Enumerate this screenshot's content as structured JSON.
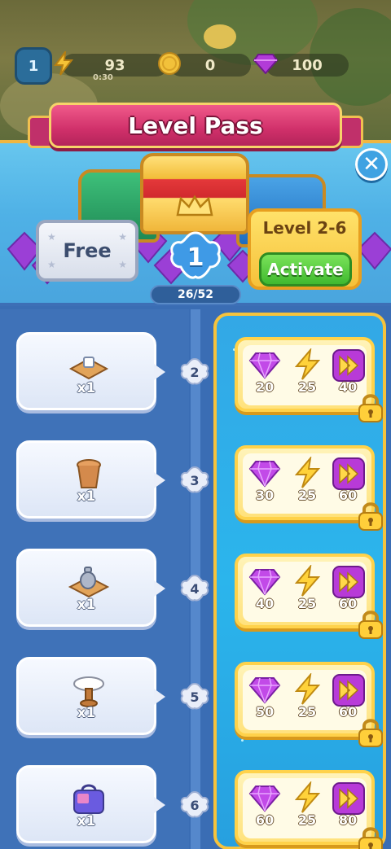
{
  "resources": {
    "player_level": "1",
    "energy": "93",
    "energy_timer": "0:30",
    "coins": "0",
    "gems": "100"
  },
  "banner": {
    "title": "Level Pass"
  },
  "header": {
    "free_label": "Free",
    "current_level": "1",
    "pass_level_label": "Level 2-6",
    "activate_label": "Activate",
    "progress_text": "26/52"
  },
  "rows": [
    {
      "level": "2",
      "free_item": "coffee-tray-icon",
      "free_qty": "x1",
      "gems": "20",
      "energy": "25",
      "boost": "40"
    },
    {
      "level": "3",
      "free_item": "stool-icon",
      "free_qty": "x1",
      "gems": "30",
      "energy": "25",
      "boost": "60"
    },
    {
      "level": "4",
      "free_item": "teapot-tray-icon",
      "free_qty": "x1",
      "gems": "40",
      "energy": "25",
      "boost": "60"
    },
    {
      "level": "5",
      "free_item": "plate-stand-icon",
      "free_qty": "x1",
      "gems": "50",
      "energy": "25",
      "boost": "60"
    },
    {
      "level": "6",
      "free_item": "handbag-icon",
      "free_qty": "x1",
      "gems": "60",
      "energy": "25",
      "boost": "80"
    }
  ],
  "colors": {
    "accent_gold": "#f6c33c",
    "ribbon_pink": "#d0306a",
    "activate_green": "#3fb92f",
    "gem_purple": "#b23bd8"
  }
}
